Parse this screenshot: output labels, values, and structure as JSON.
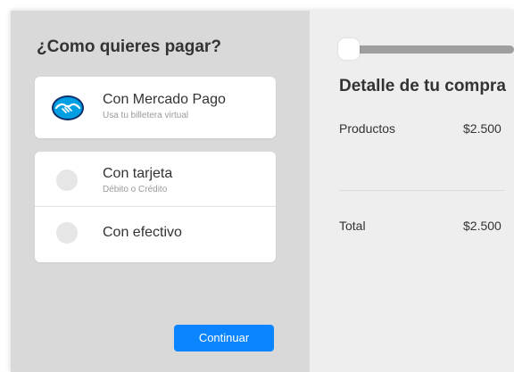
{
  "payment": {
    "title": "¿Como quieres pagar?",
    "options": [
      {
        "label": "Con Mercado Pago",
        "sublabel": "Usa tu billetera virtual",
        "icon": "mercado-pago-handshake-icon"
      },
      {
        "label": "Con tarjeta",
        "sublabel": "Débito o Crédito",
        "selected": false
      },
      {
        "label": "Con efectivo",
        "selected": false
      }
    ],
    "continue_label": "Continuar"
  },
  "summary": {
    "progress": 0.0,
    "title": "Detalle de tu compra",
    "rows": [
      {
        "label": "Productos",
        "value": "$2.500"
      },
      {
        "label": "Total",
        "value": "$2.500"
      }
    ]
  },
  "colors": {
    "accent": "#0a84ff",
    "left_panel": "#d9d9d9",
    "right_panel": "#eeeeee",
    "mercado_pago": "#009ee3"
  }
}
